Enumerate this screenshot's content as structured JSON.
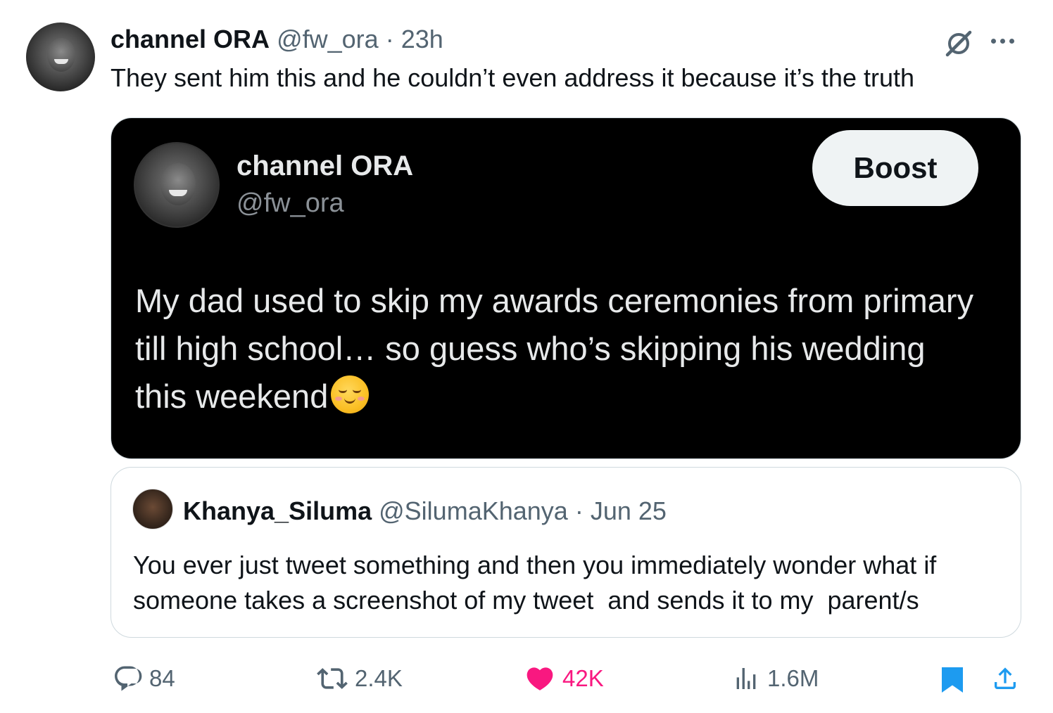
{
  "post": {
    "author_name": "channel ORA",
    "author_handle": "@fw_ora",
    "separator": "·",
    "timestamp": "23h",
    "text": "They sent him this and he couldn’t even address it because it’s the truth"
  },
  "screenshot_card": {
    "name": "channel ORA",
    "handle": "@fw_ora",
    "boost_label": "Boost",
    "text": "My dad used to skip my awards ceremonies from primary till high school… so guess who’s skipping his wedding this weekend",
    "emoji": "relieved-face-emoji"
  },
  "quote": {
    "name": "Khanya_Siluma",
    "handle": "@SilumaKhanya",
    "separator": "·",
    "date": "Jun 25",
    "text": "You ever just tweet something and then you immediately wonder what if someone takes a screenshot of my tweet  and sends it to my  parent/s"
  },
  "actions": {
    "replies": "84",
    "reposts": "2.4K",
    "likes": "42K",
    "views": "1.6M"
  },
  "colors": {
    "like_active": "#f91880",
    "bookmark_active": "#1d9bf0",
    "muted": "#536471"
  },
  "icons": [
    "grok-icon",
    "more-icon",
    "reply-icon",
    "retweet-icon",
    "heart-icon",
    "views-icon",
    "bookmark-icon",
    "share-icon"
  ]
}
